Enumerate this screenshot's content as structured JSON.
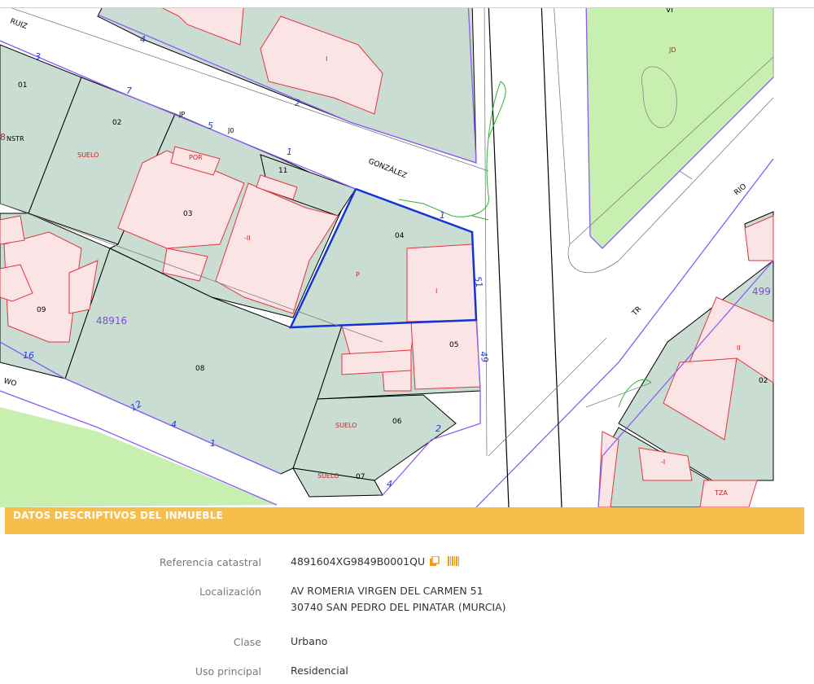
{
  "map": {
    "parcel_numbers": [
      "01",
      "02",
      "03",
      "04",
      "05",
      "06",
      "07",
      "08",
      "09",
      "11",
      "02"
    ],
    "street_labels": [
      "RUIZ",
      "GONZÁLEZ",
      "RIO",
      "TR",
      "WO"
    ],
    "block_ids": [
      "48916",
      "499"
    ],
    "use_labels": [
      "SUELO",
      "SUELO",
      "SUELO",
      "POR",
      "P",
      "I",
      "II",
      "-II",
      "-I",
      "I",
      "JD",
      "VI",
      "TZA",
      "NSTR",
      "JP",
      "J0",
      "8"
    ],
    "house_numbers": [
      "3",
      "4",
      "2",
      "5",
      "7",
      "1",
      "51",
      "49",
      "16",
      "12",
      "4",
      "1",
      "2",
      "4",
      "1"
    ]
  },
  "section": {
    "title": "DATOS DESCRIPTIVOS DEL INMUEBLE"
  },
  "fields": [
    {
      "label": "Referencia catastral",
      "value": "4891604XG9849B0001QU"
    },
    {
      "label": "Localización",
      "value": "AV ROMERIA VIRGEN DEL CARMEN 51",
      "value2": "30740 SAN PEDRO DEL PINATAR (MURCIA)"
    },
    {
      "label": "Clase",
      "value": "Urbano"
    },
    {
      "label": "Uso principal",
      "value": "Residencial"
    }
  ],
  "colors": {
    "parcel_fill": "#c9ddd2",
    "building_fill": "#fbe4e6",
    "building_stroke": "#e0373e",
    "green_fill": "#c7f0b0",
    "block_line": "#8b5cf6",
    "selection_line": "#1433d6",
    "header_bg": "#f8be4b"
  },
  "icons": [
    "copy-icon",
    "barcode-icon"
  ]
}
